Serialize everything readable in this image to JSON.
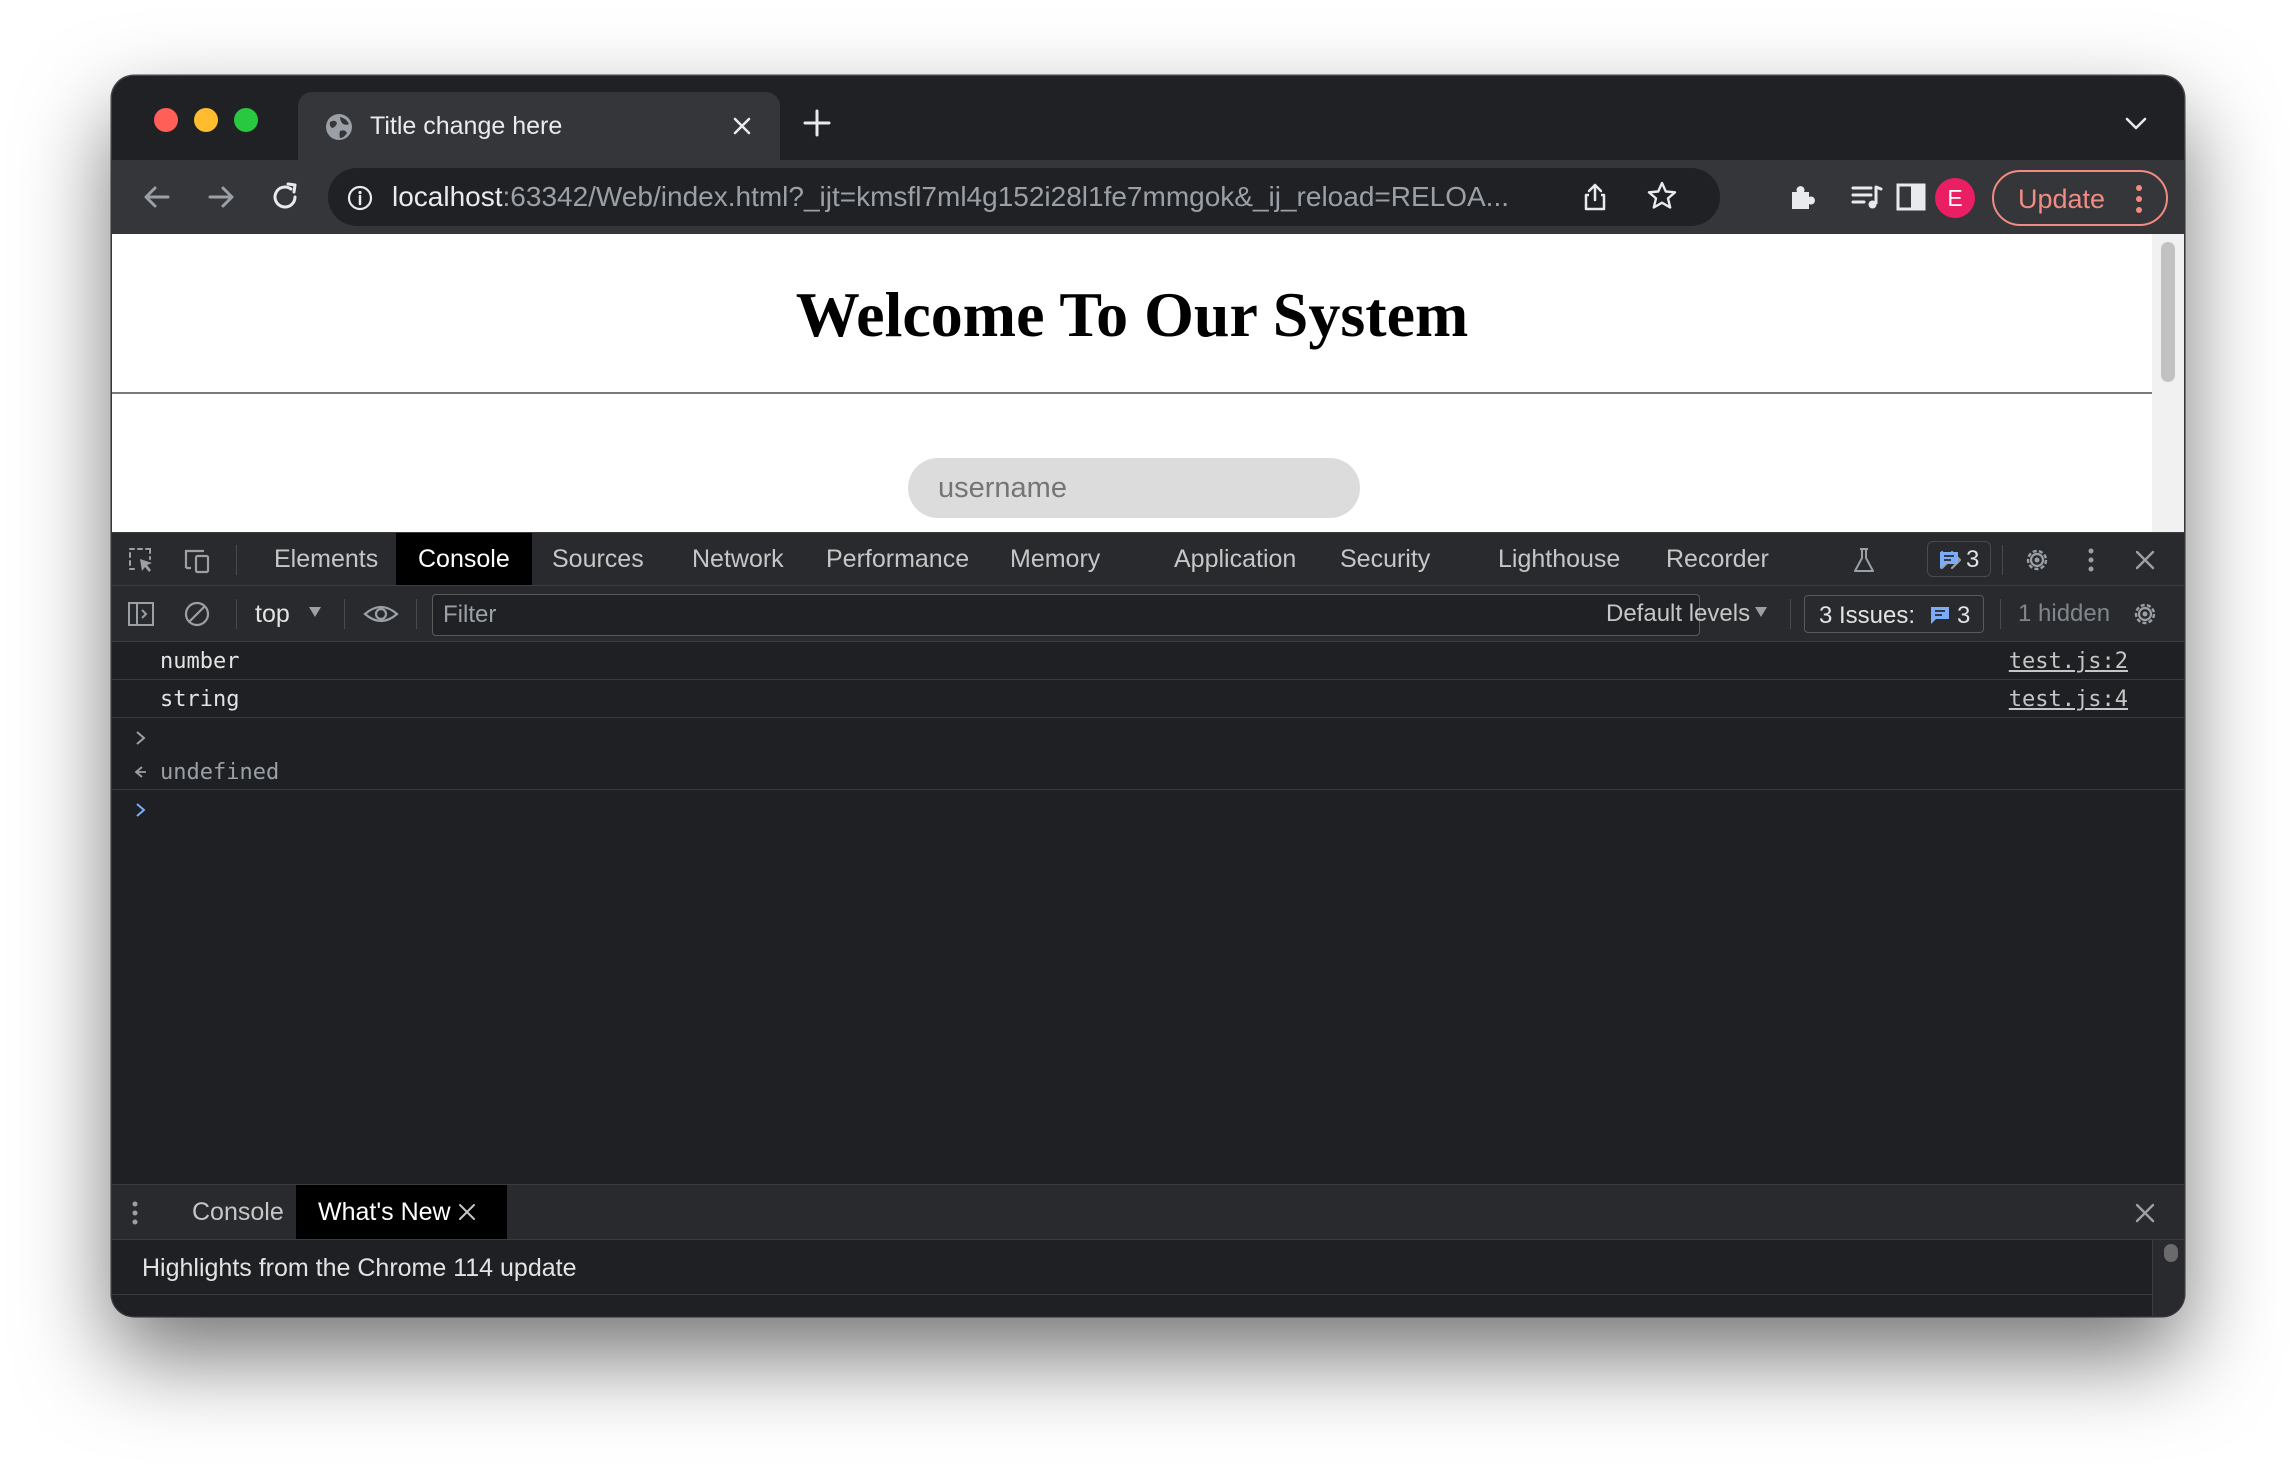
{
  "browser": {
    "tab_title": "Title change here",
    "url_host": "localhost",
    "url_rest": ":63342/Web/index.html?_ijt=kmsfl7ml4g152i28l1fe7mmgok&_ij_reload=RELOA...",
    "profile_initial": "E",
    "update_label": "Update"
  },
  "page": {
    "heading": "Welcome To Our System",
    "username_placeholder": "username"
  },
  "devtools": {
    "tabs": [
      "Elements",
      "Console",
      "Sources",
      "Network",
      "Performance",
      "Memory",
      "Application",
      "Security",
      "Lighthouse",
      "Recorder"
    ],
    "active_tab": "Console",
    "messages_badge": "3",
    "context": "top",
    "filter_placeholder": "Filter",
    "levels": "Default levels",
    "issues_label": "3 Issues:",
    "issues_count": "3",
    "hidden": "1 hidden",
    "logs": [
      {
        "text": "number",
        "source": "test.js:2"
      },
      {
        "text": "string",
        "source": "test.js:4"
      }
    ],
    "result": "undefined",
    "drawer_tabs": [
      "Console",
      "What's New"
    ],
    "drawer_active": "What's New",
    "drawer_highlight": "Highlights from the Chrome 114 update"
  },
  "colors": {
    "accent_update": "#f28b82",
    "avatar": "#e91e63",
    "prompt_blue": "#7cacf8"
  }
}
